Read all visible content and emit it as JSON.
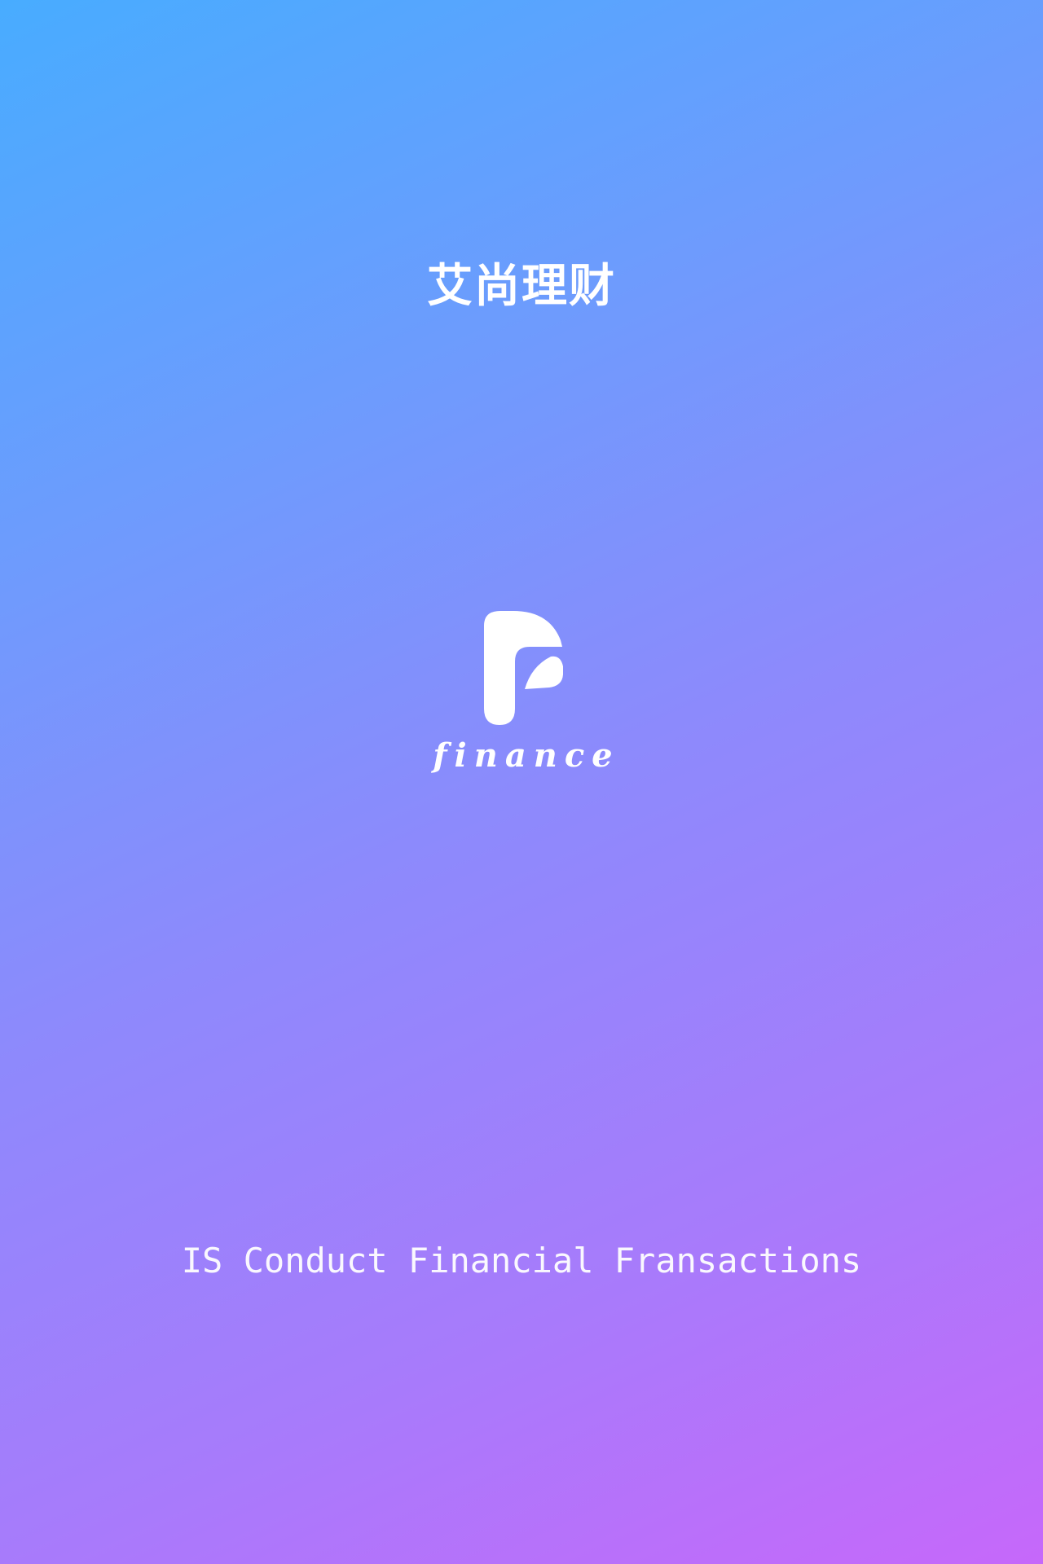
{
  "splash": {
    "title": "艾尚理财",
    "logo": {
      "icon": "finance-f-logo-icon",
      "text": "finance"
    },
    "tagline": "IS Conduct Financial Fransactions"
  },
  "colors": {
    "gradient_start": "#48acff",
    "gradient_end": "#c668fa",
    "text": "#ffffff"
  }
}
